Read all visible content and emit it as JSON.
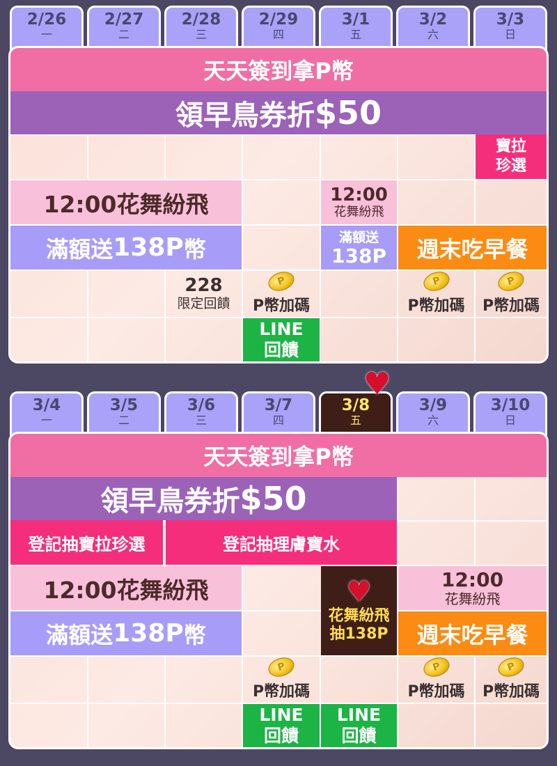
{
  "week1": {
    "tabs": [
      {
        "date": "2/26",
        "day": "一"
      },
      {
        "date": "2/27",
        "day": "二"
      },
      {
        "date": "2/28",
        "day": "三"
      },
      {
        "date": "2/29",
        "day": "四"
      },
      {
        "date": "3/1",
        "day": "五"
      },
      {
        "date": "3/2",
        "day": "六"
      },
      {
        "date": "3/3",
        "day": "日"
      }
    ],
    "checkin": "天天簽到拿P幣",
    "earlybird_prefix": "領早鳥券折",
    "earlybird_amount": "$50",
    "treasure_line1": "寶拉",
    "treasure_line2": "珍選",
    "flower_event": "12:00花舞紛飛",
    "flower_small_time": "12:00",
    "flower_small_name": "花舞紛飛",
    "fullgift_prefix": "滿額送",
    "fullgift_amount": "138P",
    "fullgift_suffix": "幣",
    "fullgift_small_line1": "滿額送",
    "fullgift_small_line2": "138P",
    "weekend": "週末吃早餐",
    "special228_line1": "228",
    "special228_line2": "限定回饋",
    "pcoin_label": "P幣加碼",
    "line_line1": "LINE",
    "line_line2": "回饋"
  },
  "week2": {
    "tabs": [
      {
        "date": "3/4",
        "day": "一"
      },
      {
        "date": "3/5",
        "day": "二"
      },
      {
        "date": "3/6",
        "day": "三"
      },
      {
        "date": "3/7",
        "day": "四"
      },
      {
        "date": "3/8",
        "day": "五"
      },
      {
        "date": "3/9",
        "day": "六"
      },
      {
        "date": "3/10",
        "day": "日"
      }
    ],
    "checkin": "天天簽到拿P幣",
    "earlybird_prefix": "領早鳥券折",
    "earlybird_amount": "$50",
    "treasure_draw": "登記抽寶拉珍選",
    "lancome_draw": "登記抽理膚寶水",
    "flower_event": "12:00花舞紛飛",
    "flower_small_time": "12:00",
    "flower_small_name": "花舞紛飛",
    "fullgift_prefix": "滿額送",
    "fullgift_amount": "138P",
    "fullgift_suffix": "幣",
    "flower_draw_line1": "花舞紛飛",
    "flower_draw_line2": "抽138P",
    "weekend": "週末吃早餐",
    "pcoin_label": "P幣加碼",
    "line_line1": "LINE",
    "line_line2": "回饋"
  },
  "colors": {
    "pink": "#f06ea3",
    "purple": "#9b62b8",
    "lavender": "#a79cf8",
    "orange": "#fb8b12",
    "green": "#1cb445",
    "hotpink": "#f52e7c",
    "brown": "#3e1e17"
  },
  "icons": [
    "coin-icon",
    "heart-icon"
  ]
}
